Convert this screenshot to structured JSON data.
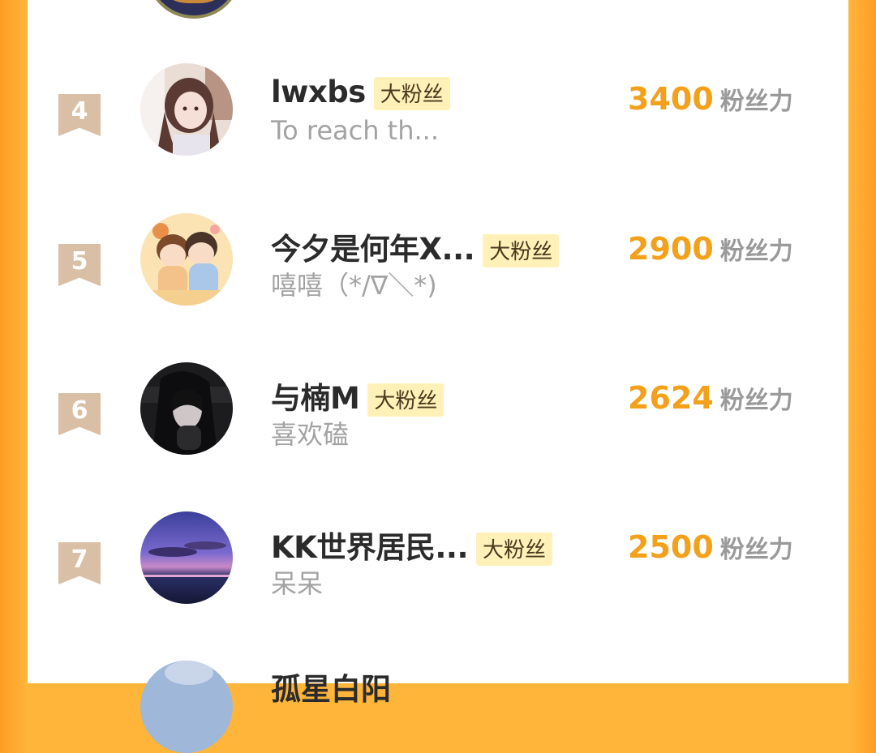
{
  "score_unit": "粉丝力",
  "colors": {
    "accent": "#f3a01b",
    "badge_bg": "#fff1b8",
    "rank_bg": "#d9bfa5",
    "frame": "#ffb43a"
  },
  "entries": [
    {
      "rank": "4",
      "name": "lwxbs",
      "badge": "大粉丝",
      "signature": "To reach th...",
      "score": "3400"
    },
    {
      "rank": "5",
      "name": "今夕是何年X...",
      "badge": "大粉丝",
      "signature": "嘻嘻（*/∇＼*)",
      "score": "2900"
    },
    {
      "rank": "6",
      "name": "与楠M",
      "badge": "大粉丝",
      "signature": "喜欢磕",
      "score": "2624"
    },
    {
      "rank": "7",
      "name": "KK世界居民...",
      "badge": "大粉丝",
      "signature": "呆呆",
      "score": "2500"
    }
  ],
  "partial_next_name": "孤星白阳"
}
